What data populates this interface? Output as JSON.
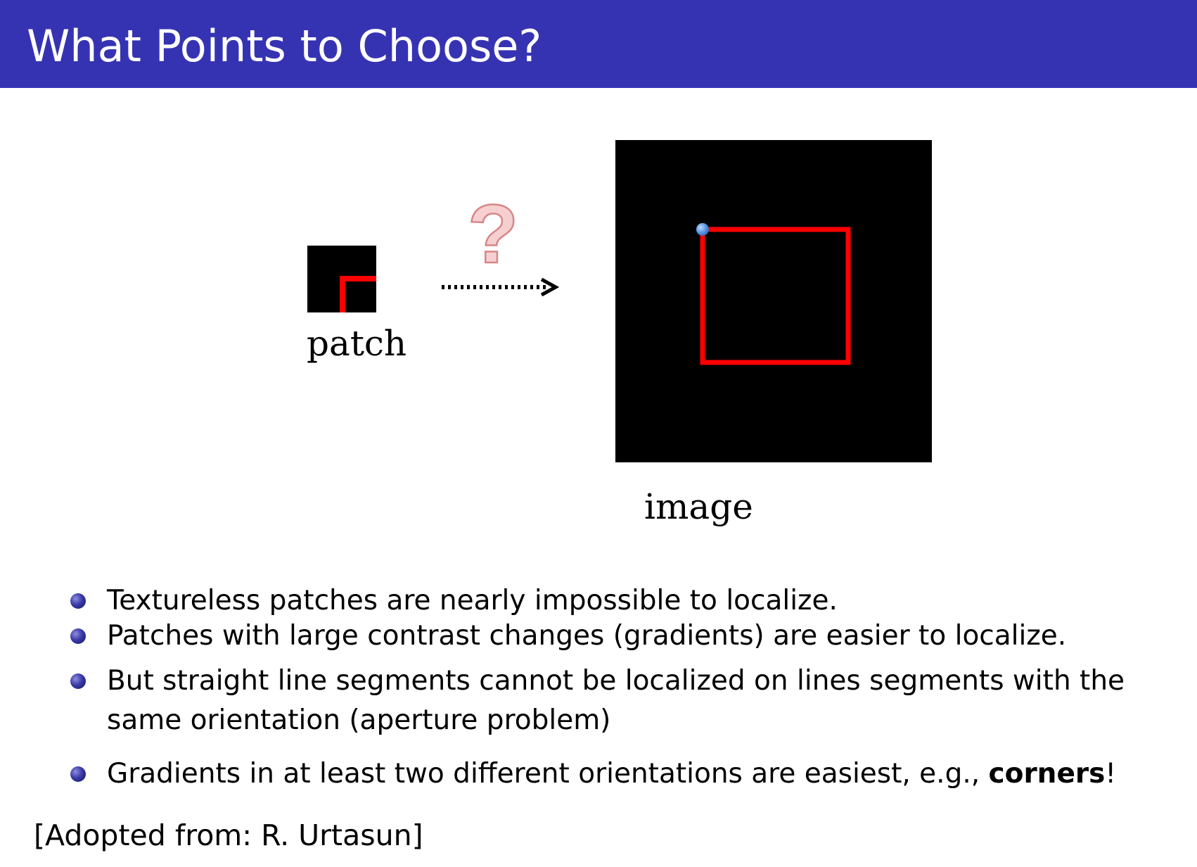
{
  "header": {
    "title": "What Points to Choose?"
  },
  "figure": {
    "patch_label": "patch",
    "image_label": "image",
    "question_mark": "?",
    "colors": {
      "background": "#000000",
      "edge": "#ff0000",
      "point": "#5b9be6",
      "question_mark": "#f4c6c6"
    }
  },
  "bullets": [
    {
      "text": "Textureless patches are nearly impossible to localize."
    },
    {
      "text": "Patches with large contrast changes (gradients) are easier to localize."
    },
    {
      "text": "But straight line segments cannot be localized on lines segments with the same orientation (aperture problem)"
    },
    {
      "text": "Gradients in at least two different orientations are easiest, e.g., ",
      "emphasis": "corners",
      "suffix": "!"
    }
  ],
  "footer": {
    "source": "[Adopted from: R. Urtasun]"
  },
  "colors": {
    "title_bar": "#3633b3",
    "title_text": "#ffffff",
    "bullet": "#2e2e9e"
  }
}
